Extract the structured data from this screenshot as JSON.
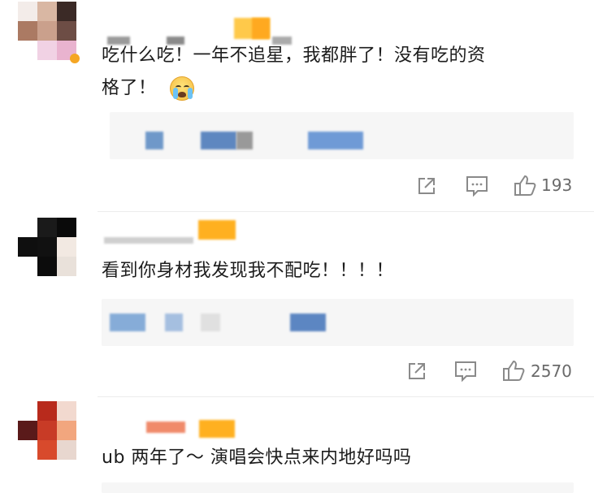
{
  "comments": [
    {
      "text_line1": "吃什么吃！一年不追星，我都胖了！没有吃的资",
      "text_line2": "格了！",
      "emoji": "loudly-crying-face",
      "likes": "193"
    },
    {
      "text_line1": "看到你身材我发现我不配吃！！！！",
      "likes": "2570"
    },
    {
      "text_line1": "ub 两年了～ 演唱会快点来内地好吗吗"
    }
  ],
  "icons": {
    "share": "share-icon",
    "comment": "comment-icon",
    "like": "thumbs-up-icon"
  },
  "colors": {
    "text": "#1c1c1c",
    "count": "#6a6a6a",
    "reply_bg": "#f6f6f6",
    "vip_orange": "#ffb020"
  }
}
